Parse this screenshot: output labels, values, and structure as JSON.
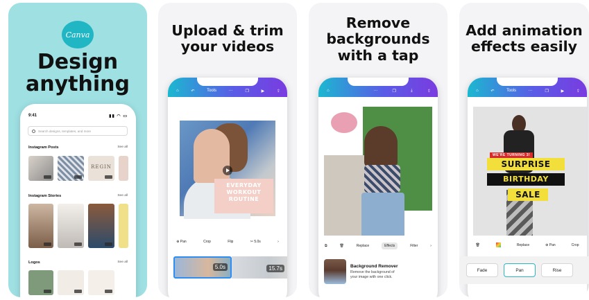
{
  "panel1": {
    "logo_text": "Canva",
    "headline_line1": "Design",
    "headline_line2": "anything",
    "time": "9:41",
    "status_icons": "▮▮ ◠ ▭",
    "search_placeholder": "Search designs, templates, and more",
    "sections": [
      {
        "title": "Instagram Posts",
        "see_all": "See all"
      },
      {
        "title": "Instagram Stories",
        "see_all": "See all"
      },
      {
        "title": "Logos",
        "see_all": "See all"
      }
    ],
    "post_thumb_text": "REGIN"
  },
  "panel2": {
    "headline_line1": "Upload & trim",
    "headline_line2": "your videos",
    "topbar_label": "Tools",
    "overlay_line1": "EVERYDAY",
    "overlay_line2": "WORKOUT",
    "overlay_line3": "ROUTINE",
    "tools": [
      "Pan",
      "Crop",
      "Flip",
      "5.0s"
    ],
    "clip1_duration": "5.0s",
    "clip2_duration": "15.7s"
  },
  "panel3": {
    "headline_line1": "Remove",
    "headline_line2": "backgrounds",
    "headline_line3": "with a tap",
    "tools": [
      "Replace",
      "Effects",
      "Filter"
    ],
    "card_title": "Background Remover",
    "card_desc_line1": "Remove the background of",
    "card_desc_line2": "your image with one click."
  },
  "panel4": {
    "headline_line1": "Add animation",
    "headline_line2": "effects easily",
    "topbar_label": "Tools",
    "ribbon_text": "WE'RE TURNING 3!",
    "banner1": "SURPRISE",
    "banner2": "BIRTHDAY",
    "banner3": "SALE",
    "tools": [
      "Replace",
      "Pan",
      "Crop"
    ],
    "animations": [
      "Fade",
      "Pan",
      "Rise"
    ],
    "selected_animation": "Pan"
  },
  "colors": {
    "panel1_bg": "#9fe0e3",
    "canva_teal": "#21b6c4",
    "topbar_gradient_start": "#1bb8d0",
    "topbar_gradient_end": "#7a3be0",
    "banner_yellow": "#f2df3b"
  }
}
